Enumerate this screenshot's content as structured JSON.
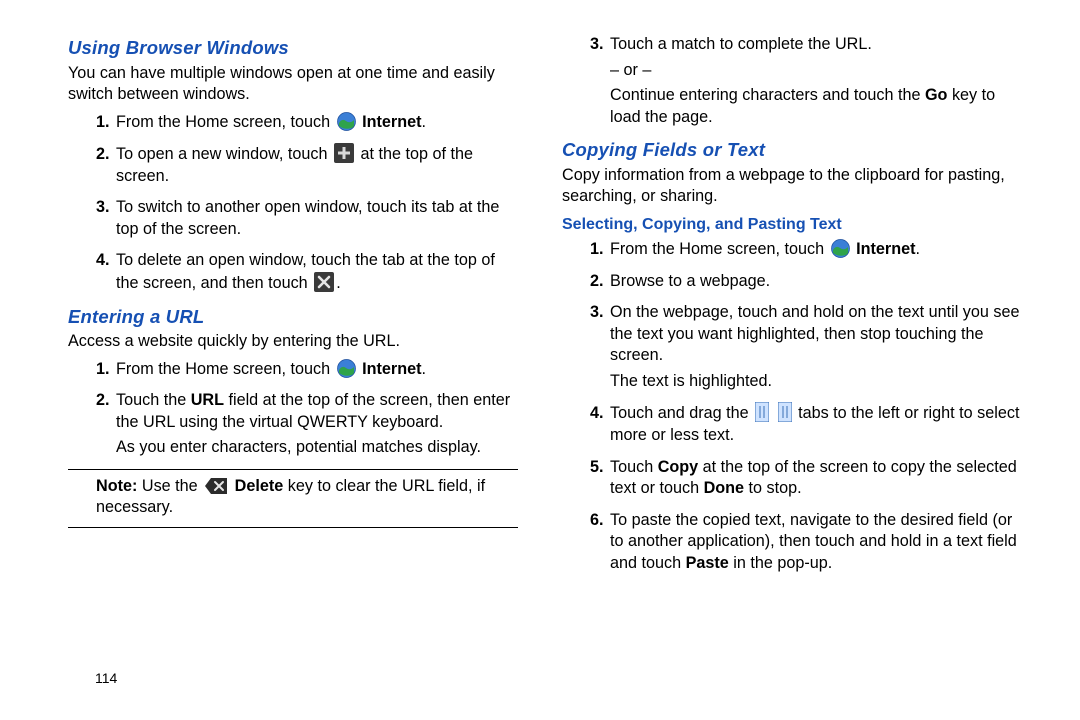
{
  "left": {
    "heading1": "Using Browser Windows",
    "intro1": "You can have multiple windows open at one time and easily switch between windows.",
    "l1_1a": "From the Home screen, touch ",
    "l1_1b": "Internet",
    "l1_1c": ".",
    "l1_2a": "To open a new window, touch ",
    "l1_2b": " at the top of the screen.",
    "l1_3": "To switch to another open window, touch its tab at the top of the screen.",
    "l1_4a": "To delete an open window, touch the tab at the top of the screen, and then touch ",
    "l1_4b": ".",
    "heading2": "Entering a URL",
    "intro2": "Access a website quickly by entering the URL.",
    "l2_1a": "From the Home screen, touch ",
    "l2_1b": "Internet",
    "l2_1c": ".",
    "l2_2a": "Touch the ",
    "l2_2b": "URL",
    "l2_2c": " field at the top of the screen, then enter the URL using the virtual QWERTY keyboard.",
    "l2_2d": "As you enter characters, potential matches display.",
    "noteLabel": "Note:",
    "note_a": " Use the ",
    "note_b": "Delete",
    "note_c": " key to clear the URL field, if necessary.",
    "pageNum": "114"
  },
  "right": {
    "r1_3a": "Touch a match to complete the URL.",
    "r1_3b": "– or –",
    "r1_3c": "Continue entering characters and touch the ",
    "r1_3d": "Go",
    "r1_3e": " key to load the page.",
    "heading3": "Copying Fields or Text",
    "intro3": "Copy information from a webpage to the clipboard for pasting, searching, or sharing.",
    "heading3sub": "Selecting, Copying, and Pasting Text",
    "s1a": "From the Home screen, touch ",
    "s1b": "Internet",
    "s1c": ".",
    "s2": "Browse to a webpage.",
    "s3a": "On the webpage, touch and hold on the text until you see the text you want highlighted, then stop touching the screen.",
    "s3b": "The text is highlighted.",
    "s4a": "Touch and drag the ",
    "s4b": " tabs to the left or right to select more or less text.",
    "s5a": "Touch ",
    "s5b": "Copy",
    "s5c": " at the top of the screen to copy the selected text or touch ",
    "s5d": "Done",
    "s5e": " to stop.",
    "s6a": "To paste the copied text, navigate to the desired field (or to another application), then touch and hold in a text field and touch ",
    "s6b": "Paste",
    "s6c": " in the pop-up."
  }
}
